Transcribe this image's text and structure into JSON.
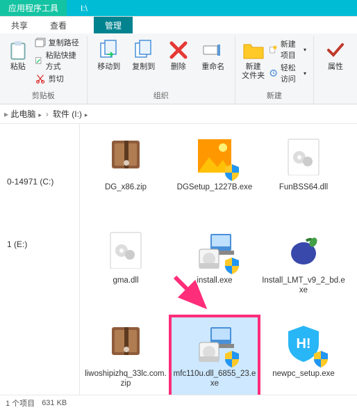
{
  "titlebar": {
    "tools_tab": "应用程序工具",
    "path_tab": "I:\\"
  },
  "tabs2": {
    "share": "共享",
    "view": "查看",
    "manage": "管理"
  },
  "ribbon": {
    "clipboard": {
      "paste": "粘贴",
      "copy_path": "复制路径",
      "paste_shortcut": "粘贴快捷方式",
      "cut": "剪切",
      "group": "剪贴板"
    },
    "organize": {
      "move_to": "移动到",
      "copy_to": "复制到",
      "delete": "删除",
      "rename": "重命名",
      "group": "组织"
    },
    "new": {
      "new_folder": "新建\n文件夹",
      "new_item": "新建项目",
      "easy_access": "轻松访问",
      "group": "新建"
    },
    "props": {
      "properties": "属性"
    }
  },
  "breadcrumb": {
    "pc": "此电脑",
    "drive": "软件 (I:)"
  },
  "sidebar": {
    "items": [
      "0-14971 (C:)",
      "1 (E:)"
    ]
  },
  "files": [
    {
      "name": "DG_x86.zip",
      "kind": "zip",
      "selected": false
    },
    {
      "name": "DGSetup_1227B.exe",
      "kind": "setup-img",
      "selected": false
    },
    {
      "name": "FunBSS64.dll",
      "kind": "dll",
      "selected": false
    },
    {
      "name": "gma.dll",
      "kind": "dll",
      "selected": false
    },
    {
      "name": "install.exe",
      "kind": "installer",
      "selected": false
    },
    {
      "name": "Install_LMT_v9_2_bd.exe",
      "kind": "plum",
      "selected": false
    },
    {
      "name": "liwoshipizhq_33lc.com.zip",
      "kind": "zip",
      "selected": false
    },
    {
      "name": "mfc110u.dll_6855_23.exe",
      "kind": "installer",
      "selected": true
    },
    {
      "name": "newpc_setup.exe",
      "kind": "hi",
      "selected": false
    }
  ],
  "status": {
    "selection": "1 个项目",
    "size": "631 KB"
  }
}
